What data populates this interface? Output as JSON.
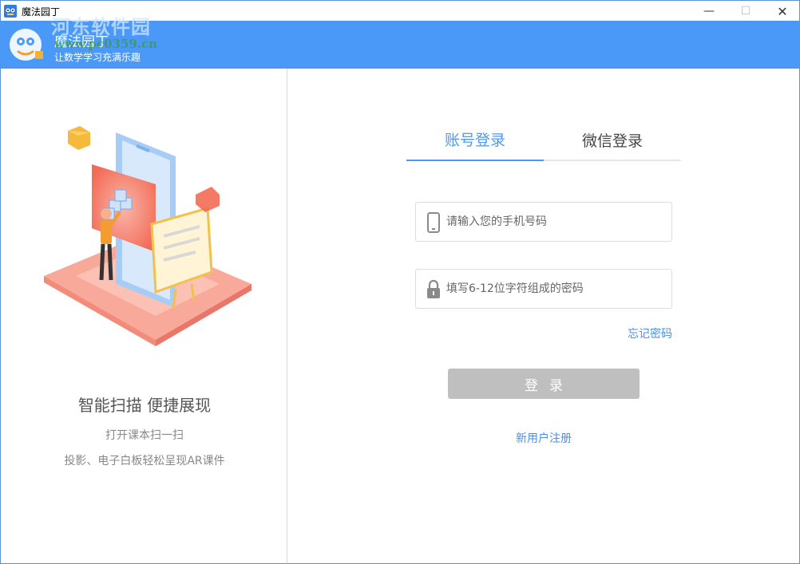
{
  "window": {
    "title": "魔法园丁",
    "minimize_glyph": "—",
    "maximize_glyph": "☐",
    "close_glyph": "✕"
  },
  "header": {
    "app_name": "魔法园丁",
    "slogan": "让数学学习充满乐趣",
    "watermark_title": "河东软件园",
    "watermark_url": "www.pc0359.cn",
    "accent_color": "#4a99f9"
  },
  "left": {
    "feature_title": "智能扫描  便捷展现",
    "feature_line1": "打开课本扫一扫",
    "feature_line2": "投影、电子白板轻松呈现AR课件"
  },
  "tabs": [
    {
      "label": "账号登录",
      "active": true
    },
    {
      "label": "微信登录",
      "active": false
    }
  ],
  "form": {
    "phone_placeholder": "请输入您的手机号码",
    "phone_icon": "phone-icon",
    "password_placeholder": "填写6-12位字符组成的密码",
    "password_icon": "lock-icon",
    "forgot_label": "忘记密码",
    "login_label": "登录",
    "register_label": "新用户注册"
  }
}
